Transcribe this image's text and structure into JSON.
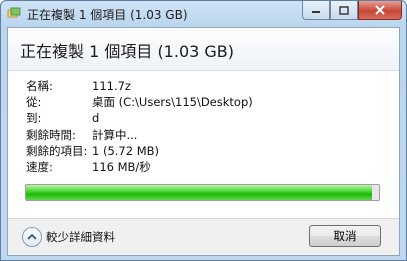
{
  "window": {
    "title": "正在複製 1 個項目 (1.03 GB)",
    "icon": "folder-copy-icon"
  },
  "caption_buttons": {
    "minimize": "minimize-icon",
    "maximize": "maximize-icon",
    "close": "close-icon"
  },
  "header": {
    "title": "正在複製 1 個項目 (1.03 GB)"
  },
  "details": [
    {
      "label": "名稱:",
      "value": "111.7z"
    },
    {
      "label": "從:",
      "value": "桌面 (C:\\Users\\115\\Desktop)"
    },
    {
      "label": "到:",
      "value": "d"
    },
    {
      "label": "剩餘時間:",
      "value": "計算中..."
    },
    {
      "label": "剩餘的項目:",
      "value": "1 (5.72 MB)"
    },
    {
      "label": "速度:",
      "value": "116 MB/秒"
    }
  ],
  "progress": {
    "fraction": 0.98
  },
  "footer": {
    "toggle_label": "較少詳細資料",
    "cancel_label": "取消"
  },
  "colors": {
    "progress_fill": "#1fb80c",
    "titlebar": "#bcd6ee"
  }
}
